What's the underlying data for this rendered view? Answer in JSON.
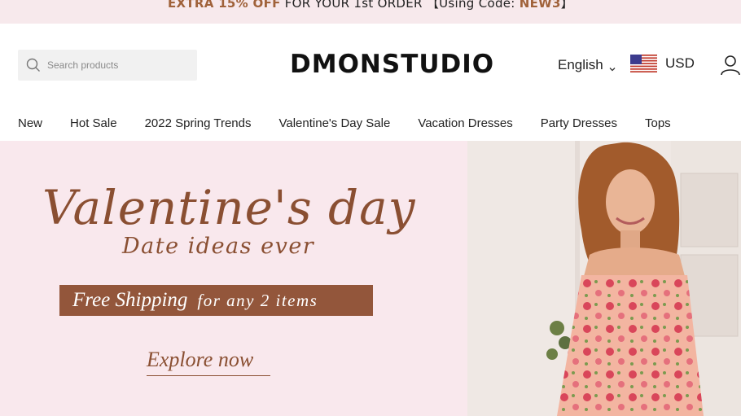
{
  "announcement": {
    "highlight": "EXTRA 15% OFF",
    "text": " FOR YOUR 1st ORDER 【Using Code: ",
    "code": "NEW3",
    "end": "】"
  },
  "header": {
    "search_placeholder": "Search products",
    "logo": "DMONSTUDIO",
    "language": "English",
    "currency": "USD"
  },
  "nav": {
    "items": [
      "New",
      "Hot Sale",
      "2022 Spring Trends",
      "Valentine's Day Sale",
      "Vacation Dresses",
      "Party Dresses",
      "Tops"
    ]
  },
  "hero": {
    "title": "Valentine's day",
    "subtitle": "Date ideas ever",
    "shipping_strong": "Free Shipping",
    "shipping_rest": "for any 2 items",
    "cta": "Explore now"
  },
  "colors": {
    "announce_bg": "#f7e9ec",
    "accent_brown": "#8a4f32",
    "banner_brown": "#93563b",
    "hero_bg": "#f9e8ed"
  },
  "icons": [
    "search-icon",
    "chevron-down-icon",
    "us-flag-icon",
    "user-icon"
  ]
}
